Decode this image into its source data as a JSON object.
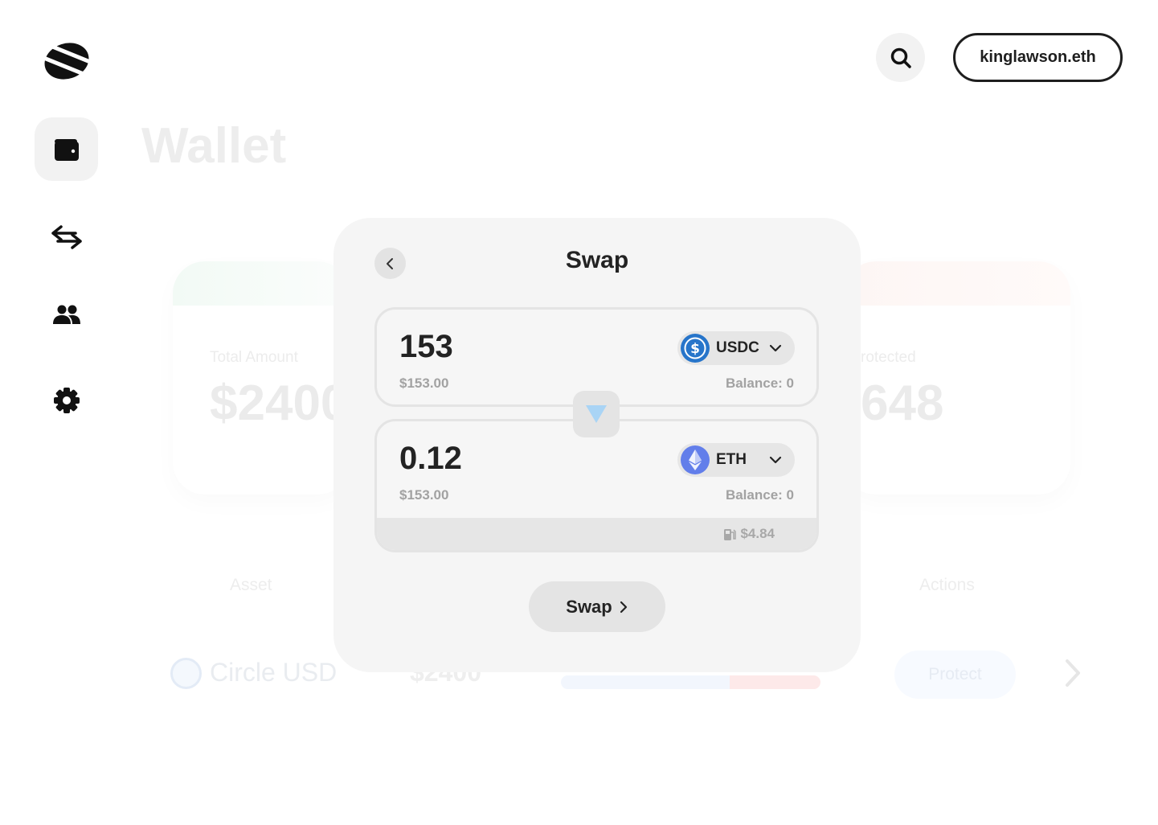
{
  "header": {
    "account_label": "kinglawson.eth"
  },
  "sidebar": {
    "items": [
      {
        "icon": "wallet-icon",
        "active": true
      },
      {
        "icon": "swap-arrows-icon",
        "active": false
      },
      {
        "icon": "people-icon",
        "active": false
      },
      {
        "icon": "gear-icon",
        "active": false
      }
    ]
  },
  "background": {
    "page_title": "Wallet",
    "total_amount_label": "Total Amount",
    "total_amount_value": "$2400",
    "protected_label": "rotected",
    "protected_value": "648",
    "col_asset": "Asset",
    "col_actions": "Actions",
    "row_asset_name": "Circle USD",
    "row_amount": "$2400",
    "row_action": "Protect"
  },
  "modal": {
    "title": "Swap",
    "from": {
      "amount": "153",
      "usd_value": "$153.00",
      "token": "USDC",
      "balance": "Balance: 0"
    },
    "to": {
      "amount": "0.12",
      "usd_value": "$153.00",
      "token": "ETH",
      "balance": "Balance: 0"
    },
    "gas_fee": "$4.84",
    "swap_button": "Swap",
    "colors": {
      "usdc": "#2775CA",
      "eth": "#627EEA",
      "flip_arrow": "#a9d4f5"
    }
  }
}
